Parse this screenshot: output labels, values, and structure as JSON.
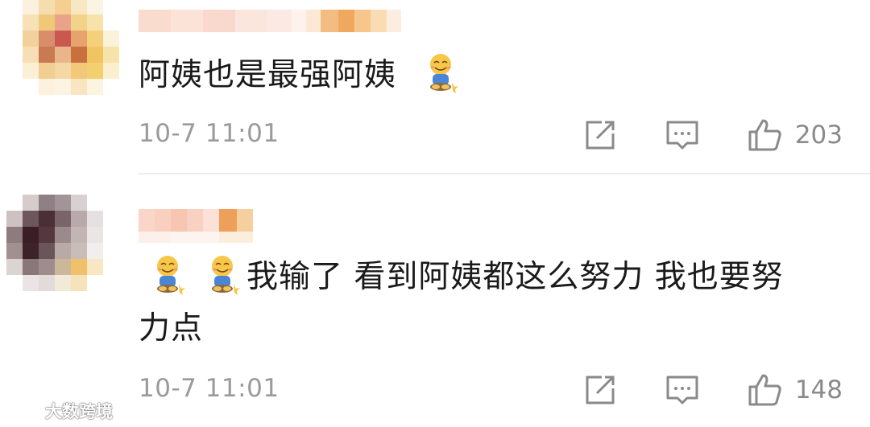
{
  "comments": [
    {
      "text": "阿姨也是最强阿姨",
      "timestamp": "10-7 11:01",
      "like_count": "203",
      "leading_emojis": 0,
      "trailing_emoji": "sitting-smile-emoji"
    },
    {
      "line1": "我输了 看到阿姨都这么努力 我也要努",
      "line2": "力点",
      "timestamp": "10-7 11:01",
      "like_count": "148",
      "leading_emojis": 2,
      "leading_emoji": "sitting-smile-emoji"
    }
  ],
  "icons": {
    "share": "share-icon",
    "reply": "reply-icon",
    "like": "thumbs-up-icon"
  },
  "watermark": {
    "text": "大数跨境",
    "logo": "watermark-logo-icon"
  },
  "colors": {
    "text": "#1a1a1a",
    "meta": "#9a9a9a",
    "divider": "#ededed"
  }
}
